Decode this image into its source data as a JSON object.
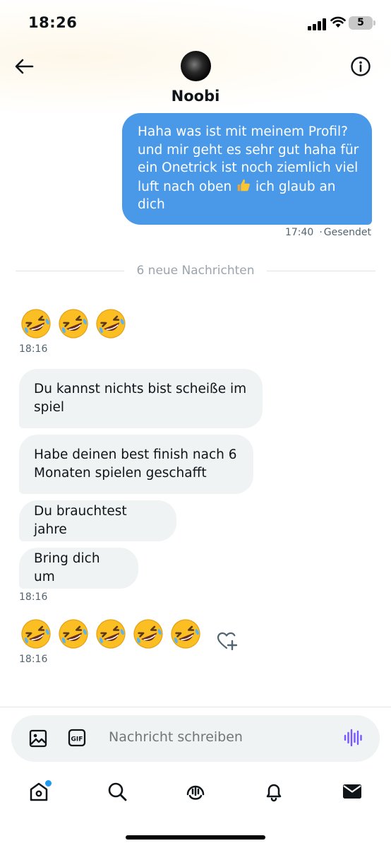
{
  "status_bar": {
    "time": "18:26",
    "battery": "5"
  },
  "header": {
    "contact_name": "Noobi"
  },
  "messages": {
    "sent": {
      "lines": [
        "Haha was ist mit meinem Profil?",
        "und mir geht es sehr gut haha für",
        "ein Onetrick ist noch ziemlich viel",
        "luft nach oben",
        "ich glaub an",
        "dich"
      ],
      "time": "17:40",
      "status": "Gesendet"
    },
    "new_divider": "6 neue Nachrichten",
    "received_group1": {
      "emoji_count": 3,
      "time": "18:16"
    },
    "received": [
      {
        "lines": [
          "Du kannst nichts bist scheiße im",
          "spiel"
        ]
      },
      {
        "lines": [
          "Habe deinen best finish nach 6",
          "Monaten spielen geschafft"
        ]
      },
      {
        "lines": [
          "Du brauchtest jahre"
        ]
      },
      {
        "lines": [
          "Bring dich um"
        ]
      }
    ],
    "received_time": "18:16",
    "received_group3": {
      "emoji_count": 5,
      "time": "18:16"
    }
  },
  "composer": {
    "placeholder": "Nachricht schreiben"
  },
  "icons": {
    "back": "arrow-left-icon",
    "info": "info-icon",
    "image": "image-icon",
    "gif": "gif-icon",
    "voice": "voice-wave-icon",
    "reaction": "heart-plus-icon",
    "tabs": [
      "home-icon",
      "search-icon",
      "spaces-icon",
      "notifications-icon",
      "messages-icon"
    ]
  },
  "colors": {
    "accent": "#1d9bf0",
    "sent_bubble": "#4a99e9",
    "received_bubble": "#eff3f4",
    "voice_icon": "#7856ff"
  }
}
